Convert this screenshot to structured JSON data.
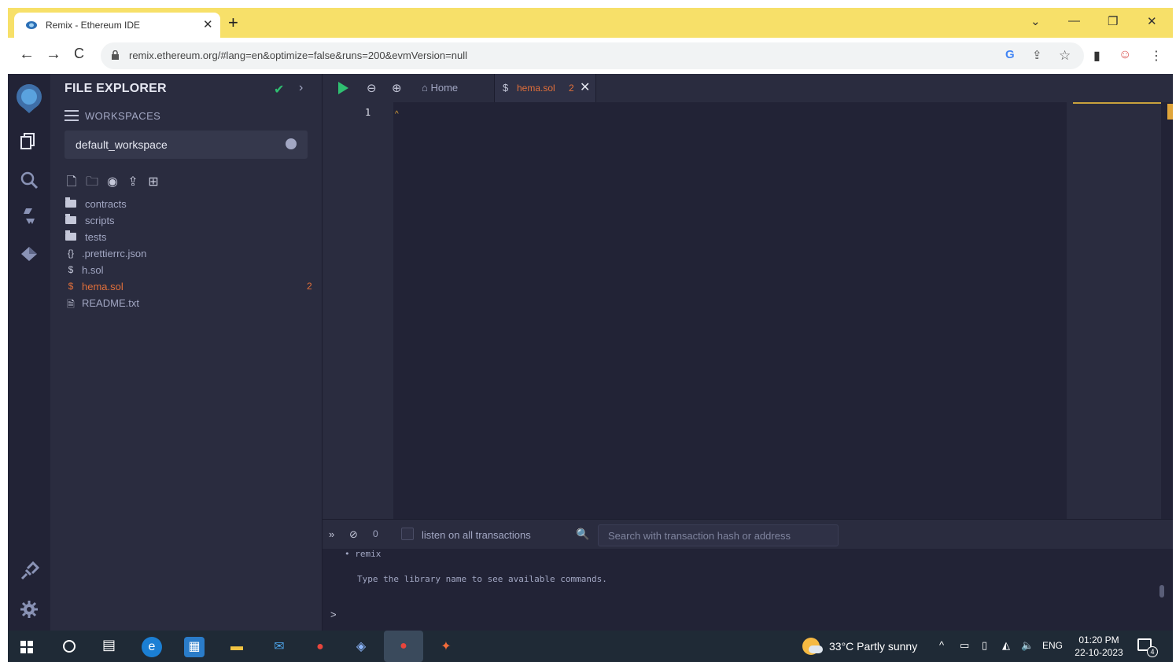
{
  "browser": {
    "tab_title": "Remix - Ethereum IDE",
    "tab_close": "✕",
    "new_tab": "+",
    "url": "remix.ethereum.org/#lang=en&optimize=false&runs=200&evmVersion=null",
    "win_controls": {
      "tabsearch": "⌄",
      "minimize": "—",
      "restore": "❐",
      "close": "✕"
    },
    "nav": {
      "back": "←",
      "forward": "→",
      "reload": "C"
    },
    "omni_icons": {
      "google": "G",
      "share": "⇪",
      "bookmark": "☆"
    },
    "ext_icons": {
      "sidepanel": "▮",
      "profile": "☺",
      "menu": "⋮"
    }
  },
  "remix": {
    "file_explorer": {
      "title": "FILE EXPLORER",
      "check": "✔",
      "arrow": "›",
      "workspaces_label": "WORKSPACES",
      "workspace_selected": "default_workspace",
      "actions": [
        "🗋",
        "🗀",
        "◉",
        "⇪",
        "⊞"
      ],
      "items": [
        {
          "type": "folder",
          "label": "contracts"
        },
        {
          "type": "folder",
          "label": "scripts"
        },
        {
          "type": "folder",
          "label": "tests"
        },
        {
          "type": "json",
          "icon": "{}",
          "label": ".prettierrc.json"
        },
        {
          "type": "sol",
          "icon": "$",
          "label": "h.sol"
        },
        {
          "type": "sol",
          "icon": "$",
          "label": "hema.sol",
          "badge": "2",
          "active": true
        },
        {
          "type": "txt",
          "icon": "🗎",
          "label": "README.txt"
        }
      ]
    },
    "editor": {
      "home_tab": "Home",
      "home_icon": "⌂",
      "zoom_out": "⊖",
      "zoom_in": "⊕",
      "file_tab": {
        "icon": "$",
        "label": "hema.sol",
        "badge": "2",
        "close": "✕"
      },
      "line_number": "1",
      "cursor": "^"
    },
    "terminal": {
      "collapse": "»",
      "clear": "⊘",
      "count": "0",
      "listen_label": "listen on all transactions",
      "search_icon": "🔍",
      "search_placeholder": "Search with transaction hash or address",
      "line_remix": "• remix",
      "line_help": "Type the library name to see available commands.",
      "prompt": ">"
    }
  },
  "taskbar": {
    "weather": "33°C  Partly sunny",
    "lang": "ENG",
    "time": "01:20 PM",
    "date": "22-10-2023",
    "notifications": "4",
    "tray": {
      "chevron": "^",
      "battery": "▭",
      "display": "▯",
      "wifi": "◭",
      "volume": "🔈"
    },
    "apps": {
      "edge": "e",
      "store": "▦",
      "files": "▬",
      "mail": "✉",
      "chrome": "●",
      "app1": "◈",
      "chrome2": "●",
      "app2": "✦"
    }
  },
  "colors": {
    "tabstrip": "#f7e069",
    "remix_bg": "#2a2c3f",
    "accent_orange": "#e16f3a",
    "accent_green": "#2fbf71",
    "taskbar": "#1f2a36"
  }
}
